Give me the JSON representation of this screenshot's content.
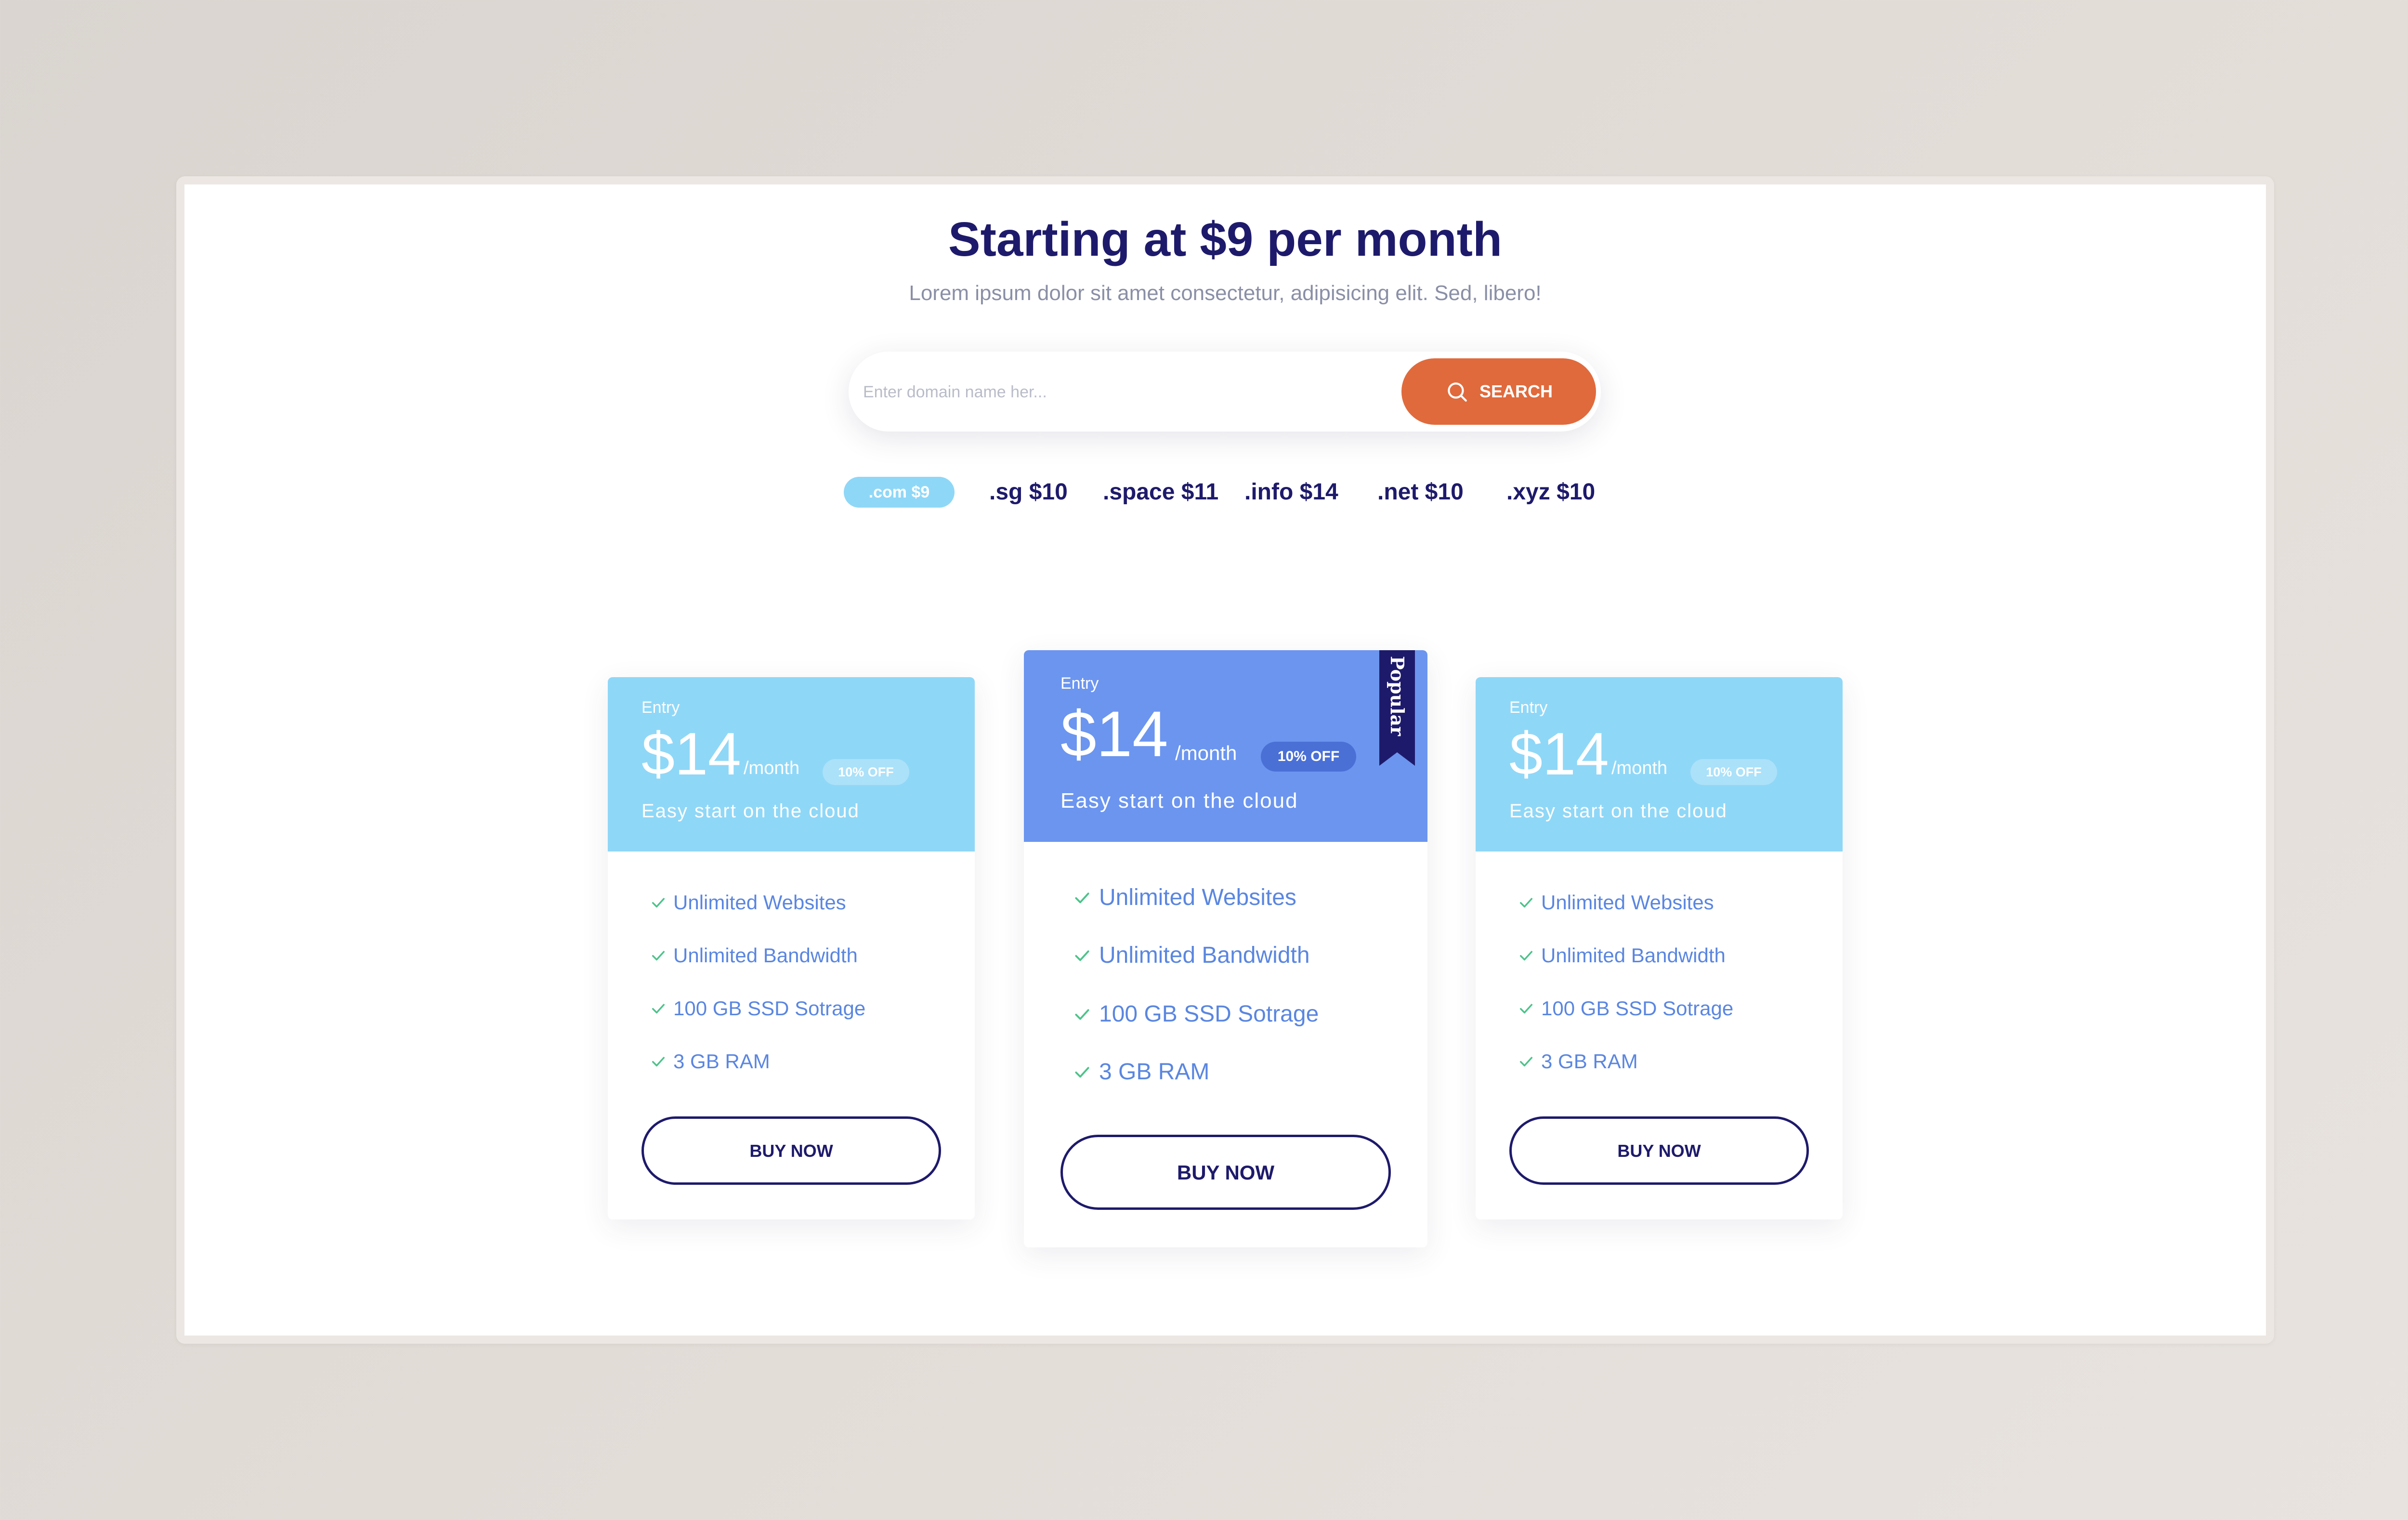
{
  "hero": {
    "title": "Starting at $9 per month",
    "subtitle": "Lorem ipsum dolor sit amet consectetur, adipisicing elit. Sed, libero!"
  },
  "search": {
    "placeholder": "Enter domain name her...",
    "button_label": "SEARCH"
  },
  "tlds": [
    {
      "label": ".com $9",
      "active": true
    },
    {
      "label": ".sg $10"
    },
    {
      "label": ".space $11"
    },
    {
      "label": ".info $14"
    },
    {
      "label": ".net $10"
    },
    {
      "label": ".xyz $10"
    }
  ],
  "plans": [
    {
      "tier": "Entry",
      "price": "$14",
      "period": "/month",
      "discount": "10% OFF",
      "tagline": "Easy start on the cloud",
      "features": [
        "Unlimited Websites",
        "Unlimited Bandwidth",
        "100 GB SSD Sotrage",
        "3 GB RAM"
      ],
      "cta": "BUY NOW"
    },
    {
      "tier": "Entry",
      "price": "$14",
      "period": "/month",
      "discount": "10% OFF",
      "tagline": "Easy start on the cloud",
      "ribbon": "Popular",
      "features": [
        "Unlimited Websites",
        "Unlimited Bandwidth",
        "100 GB SSD Sotrage",
        "3 GB RAM"
      ],
      "cta": "BUY NOW"
    },
    {
      "tier": "Entry",
      "price": "$14",
      "period": "/month",
      "discount": "10% OFF",
      "tagline": "Easy start on the cloud",
      "features": [
        "Unlimited Websites",
        "Unlimited Bandwidth",
        "100 GB SSD Sotrage",
        "3 GB RAM"
      ],
      "cta": "BUY NOW"
    }
  ],
  "colors": {
    "title": "#1e1a6b",
    "accent_orange": "#e06a3c",
    "light_blue": "#8fd7f7",
    "featured_blue": "#6b95ef",
    "ribbon_navy": "#1e1a6b",
    "feature_text": "#5a86e0",
    "check_green": "#4cc38a"
  },
  "icons": {
    "search_button": "search-icon",
    "feature": "check-icon",
    "ribbon": "bookmark-ribbon-icon"
  }
}
